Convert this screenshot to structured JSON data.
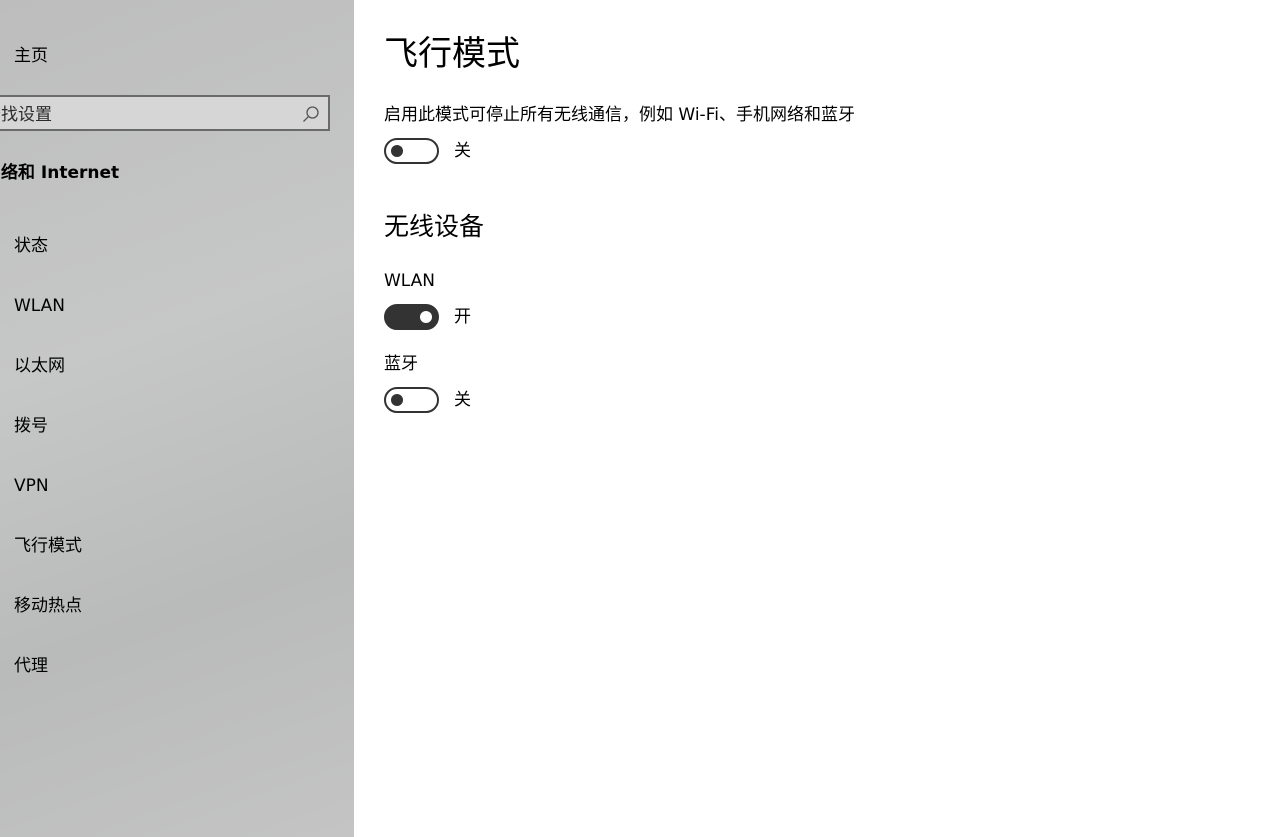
{
  "sidebar": {
    "home_label": "主页",
    "search_placeholder": "查找设置",
    "section_title": "网络和 Internet",
    "items": [
      {
        "label": "状态"
      },
      {
        "label": "WLAN"
      },
      {
        "label": "以太网"
      },
      {
        "label": "拨号"
      },
      {
        "label": "VPN"
      },
      {
        "label": "飞行模式"
      },
      {
        "label": "移动热点"
      },
      {
        "label": "代理"
      }
    ]
  },
  "main": {
    "title": "飞行模式",
    "description": "启用此模式可停止所有无线通信，例如 Wi-Fi、手机网络和蓝牙",
    "airplane_toggle": {
      "state": "关",
      "on": false
    },
    "wireless_heading": "无线设备",
    "wlan": {
      "label": "WLAN",
      "state": "开",
      "on": true
    },
    "bluetooth": {
      "label": "蓝牙",
      "state": "关",
      "on": false
    }
  },
  "colors": {
    "sidebar_bg": "#c1c2c2",
    "toggle_on": "#333333",
    "text": "#000000"
  }
}
